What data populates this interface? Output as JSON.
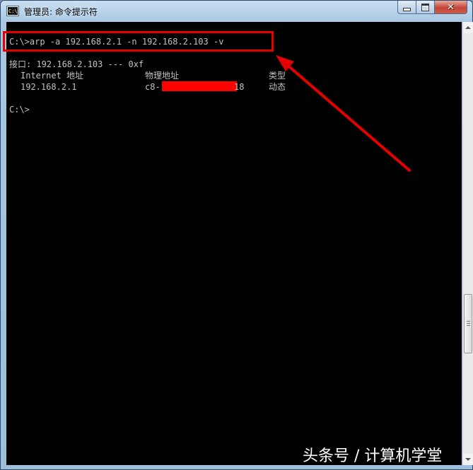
{
  "window": {
    "title": "管理员: 命令提示符",
    "icon": "console-icon",
    "icon_text": "C:\\",
    "buttons": {
      "minimize": "minimize-icon",
      "maximize": "maximize-icon",
      "close": "close-icon"
    }
  },
  "console": {
    "command_line": "C:\\>arp -a 192.168.2.1 -n 192.168.2.103 -v",
    "interface_line": "接口: 192.168.2.103 --- 0xf",
    "headers": {
      "internet_address": "Internet 地址",
      "physical_address": "物理地址",
      "type": "类型"
    },
    "entry": {
      "internet_address": "192.168.2.1",
      "mac_prefix": "c8-",
      "mac_suffix": "18",
      "type": "动态"
    },
    "prompt": "C:\\>",
    "text_color": "#c0c0c0",
    "background_color": "#000000"
  },
  "annotation": {
    "color": "#e50000"
  },
  "watermark": "头条号 / 计算机学堂"
}
